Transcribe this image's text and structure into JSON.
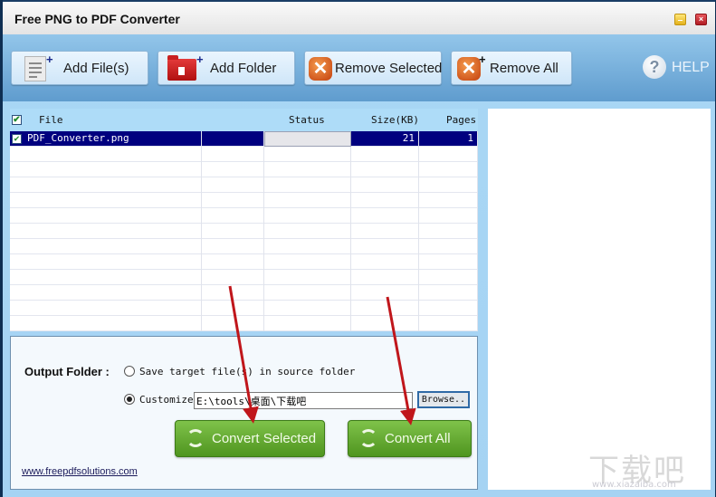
{
  "window": {
    "title": "Free PNG to PDF Converter",
    "minimize_icon": "minimize-icon",
    "close_icon": "close-icon"
  },
  "toolbar": {
    "add_files_label": "Add File(s)",
    "add_folder_label": "Add Folder",
    "remove_selected_label": "Remove Selected",
    "remove_all_label": "Remove All",
    "help_label": "HELP"
  },
  "file_list": {
    "columns": [
      "File",
      "Status",
      "Size(KB)",
      "Pages"
    ],
    "header_checked": true,
    "rows": [
      {
        "checked": true,
        "file": "PDF_Converter.png",
        "status": "",
        "size_kb": "21",
        "pages": "1",
        "selected": true
      }
    ]
  },
  "output": {
    "label": "Output Folder :",
    "option_source": "Save target file(s) in source folder",
    "option_customize": "Customize",
    "selected_option": "customize",
    "path_value": "E:\\tools\\桌面\\下载吧",
    "browse_label": "Browse..",
    "convert_selected_label": "Convert Selected",
    "convert_all_label": "Convert All",
    "website_link": "www.freepdfsolutions.com"
  },
  "annotations": {
    "arrow_color": "#c0161b"
  },
  "watermark": {
    "text": "下载吧",
    "url_text": "www.xiazaiba.com"
  }
}
